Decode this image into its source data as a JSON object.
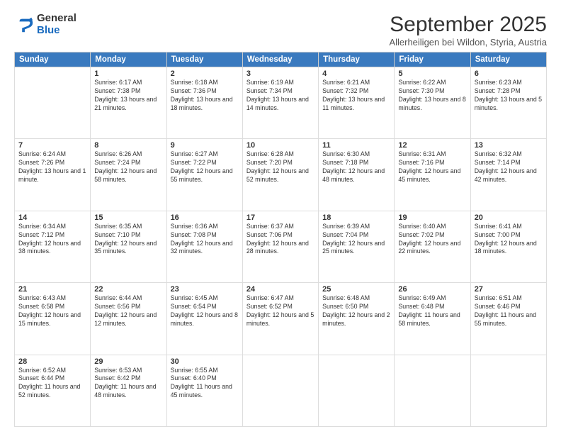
{
  "logo": {
    "general": "General",
    "blue": "Blue"
  },
  "header": {
    "month": "September 2025",
    "location": "Allerheiligen bei Wildon, Styria, Austria"
  },
  "weekdays": [
    "Sunday",
    "Monday",
    "Tuesday",
    "Wednesday",
    "Thursday",
    "Friday",
    "Saturday"
  ],
  "weeks": [
    [
      {
        "day": "",
        "sunrise": "",
        "sunset": "",
        "daylight": ""
      },
      {
        "day": "1",
        "sunrise": "Sunrise: 6:17 AM",
        "sunset": "Sunset: 7:38 PM",
        "daylight": "Daylight: 13 hours and 21 minutes."
      },
      {
        "day": "2",
        "sunrise": "Sunrise: 6:18 AM",
        "sunset": "Sunset: 7:36 PM",
        "daylight": "Daylight: 13 hours and 18 minutes."
      },
      {
        "day": "3",
        "sunrise": "Sunrise: 6:19 AM",
        "sunset": "Sunset: 7:34 PM",
        "daylight": "Daylight: 13 hours and 14 minutes."
      },
      {
        "day": "4",
        "sunrise": "Sunrise: 6:21 AM",
        "sunset": "Sunset: 7:32 PM",
        "daylight": "Daylight: 13 hours and 11 minutes."
      },
      {
        "day": "5",
        "sunrise": "Sunrise: 6:22 AM",
        "sunset": "Sunset: 7:30 PM",
        "daylight": "Daylight: 13 hours and 8 minutes."
      },
      {
        "day": "6",
        "sunrise": "Sunrise: 6:23 AM",
        "sunset": "Sunset: 7:28 PM",
        "daylight": "Daylight: 13 hours and 5 minutes."
      }
    ],
    [
      {
        "day": "7",
        "sunrise": "Sunrise: 6:24 AM",
        "sunset": "Sunset: 7:26 PM",
        "daylight": "Daylight: 13 hours and 1 minute."
      },
      {
        "day": "8",
        "sunrise": "Sunrise: 6:26 AM",
        "sunset": "Sunset: 7:24 PM",
        "daylight": "Daylight: 12 hours and 58 minutes."
      },
      {
        "day": "9",
        "sunrise": "Sunrise: 6:27 AM",
        "sunset": "Sunset: 7:22 PM",
        "daylight": "Daylight: 12 hours and 55 minutes."
      },
      {
        "day": "10",
        "sunrise": "Sunrise: 6:28 AM",
        "sunset": "Sunset: 7:20 PM",
        "daylight": "Daylight: 12 hours and 52 minutes."
      },
      {
        "day": "11",
        "sunrise": "Sunrise: 6:30 AM",
        "sunset": "Sunset: 7:18 PM",
        "daylight": "Daylight: 12 hours and 48 minutes."
      },
      {
        "day": "12",
        "sunrise": "Sunrise: 6:31 AM",
        "sunset": "Sunset: 7:16 PM",
        "daylight": "Daylight: 12 hours and 45 minutes."
      },
      {
        "day": "13",
        "sunrise": "Sunrise: 6:32 AM",
        "sunset": "Sunset: 7:14 PM",
        "daylight": "Daylight: 12 hours and 42 minutes."
      }
    ],
    [
      {
        "day": "14",
        "sunrise": "Sunrise: 6:34 AM",
        "sunset": "Sunset: 7:12 PM",
        "daylight": "Daylight: 12 hours and 38 minutes."
      },
      {
        "day": "15",
        "sunrise": "Sunrise: 6:35 AM",
        "sunset": "Sunset: 7:10 PM",
        "daylight": "Daylight: 12 hours and 35 minutes."
      },
      {
        "day": "16",
        "sunrise": "Sunrise: 6:36 AM",
        "sunset": "Sunset: 7:08 PM",
        "daylight": "Daylight: 12 hours and 32 minutes."
      },
      {
        "day": "17",
        "sunrise": "Sunrise: 6:37 AM",
        "sunset": "Sunset: 7:06 PM",
        "daylight": "Daylight: 12 hours and 28 minutes."
      },
      {
        "day": "18",
        "sunrise": "Sunrise: 6:39 AM",
        "sunset": "Sunset: 7:04 PM",
        "daylight": "Daylight: 12 hours and 25 minutes."
      },
      {
        "day": "19",
        "sunrise": "Sunrise: 6:40 AM",
        "sunset": "Sunset: 7:02 PM",
        "daylight": "Daylight: 12 hours and 22 minutes."
      },
      {
        "day": "20",
        "sunrise": "Sunrise: 6:41 AM",
        "sunset": "Sunset: 7:00 PM",
        "daylight": "Daylight: 12 hours and 18 minutes."
      }
    ],
    [
      {
        "day": "21",
        "sunrise": "Sunrise: 6:43 AM",
        "sunset": "Sunset: 6:58 PM",
        "daylight": "Daylight: 12 hours and 15 minutes."
      },
      {
        "day": "22",
        "sunrise": "Sunrise: 6:44 AM",
        "sunset": "Sunset: 6:56 PM",
        "daylight": "Daylight: 12 hours and 12 minutes."
      },
      {
        "day": "23",
        "sunrise": "Sunrise: 6:45 AM",
        "sunset": "Sunset: 6:54 PM",
        "daylight": "Daylight: 12 hours and 8 minutes."
      },
      {
        "day": "24",
        "sunrise": "Sunrise: 6:47 AM",
        "sunset": "Sunset: 6:52 PM",
        "daylight": "Daylight: 12 hours and 5 minutes."
      },
      {
        "day": "25",
        "sunrise": "Sunrise: 6:48 AM",
        "sunset": "Sunset: 6:50 PM",
        "daylight": "Daylight: 12 hours and 2 minutes."
      },
      {
        "day": "26",
        "sunrise": "Sunrise: 6:49 AM",
        "sunset": "Sunset: 6:48 PM",
        "daylight": "Daylight: 11 hours and 58 minutes."
      },
      {
        "day": "27",
        "sunrise": "Sunrise: 6:51 AM",
        "sunset": "Sunset: 6:46 PM",
        "daylight": "Daylight: 11 hours and 55 minutes."
      }
    ],
    [
      {
        "day": "28",
        "sunrise": "Sunrise: 6:52 AM",
        "sunset": "Sunset: 6:44 PM",
        "daylight": "Daylight: 11 hours and 52 minutes."
      },
      {
        "day": "29",
        "sunrise": "Sunrise: 6:53 AM",
        "sunset": "Sunset: 6:42 PM",
        "daylight": "Daylight: 11 hours and 48 minutes."
      },
      {
        "day": "30",
        "sunrise": "Sunrise: 6:55 AM",
        "sunset": "Sunset: 6:40 PM",
        "daylight": "Daylight: 11 hours and 45 minutes."
      },
      {
        "day": "",
        "sunrise": "",
        "sunset": "",
        "daylight": ""
      },
      {
        "day": "",
        "sunrise": "",
        "sunset": "",
        "daylight": ""
      },
      {
        "day": "",
        "sunrise": "",
        "sunset": "",
        "daylight": ""
      },
      {
        "day": "",
        "sunrise": "",
        "sunset": "",
        "daylight": ""
      }
    ]
  ]
}
